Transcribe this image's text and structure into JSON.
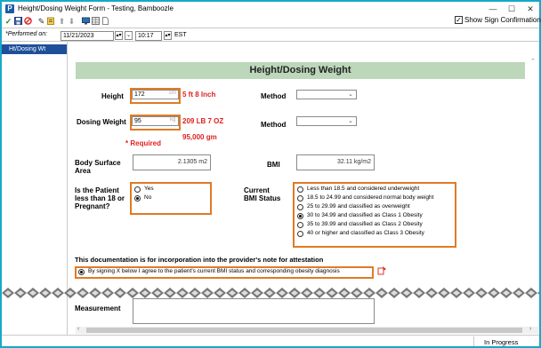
{
  "window": {
    "title": "Height/Dosing Weight Form - Testing, Bamboozle",
    "app_icon_letter": "P",
    "minimize": "—",
    "maximize": "☐",
    "close": "✕"
  },
  "toolbar": {
    "show_sign_confirmation_label": "Show Sign Confirmation",
    "show_sign_confirmation_checked": true,
    "check_mark": "✓"
  },
  "performed": {
    "label": "*Performed on:",
    "date": "11/21/2023",
    "time": "10:17",
    "timezone": "EST"
  },
  "nav": {
    "items": [
      {
        "label": "Ht/Dosing Wt"
      }
    ]
  },
  "form": {
    "section_title": "Height/Dosing Weight",
    "height": {
      "label": "Height",
      "value": "172",
      "unit": "cm",
      "converted": "5 ft 8 Inch"
    },
    "method_label": "Method",
    "dosing_weight": {
      "label": "Dosing Weight",
      "value": "95",
      "unit": "kg",
      "converted_lb": "209 LB 7 OZ",
      "converted_gm": "95,000 gm"
    },
    "required_note": "* Required",
    "bsa": {
      "label_line1": "Body Surface",
      "label_line2": "Area",
      "value": "2.1305 m2"
    },
    "bmi": {
      "label": "BMI",
      "value": "32.11 kg/m2"
    },
    "pregnant": {
      "label_line1": "Is the Patient",
      "label_line2": "less than 18 or",
      "label_line3": "Pregnant?",
      "options": [
        {
          "label": "Yes",
          "selected": false
        },
        {
          "label": "No",
          "selected": true
        }
      ]
    },
    "bmi_status": {
      "label_line1": "Current",
      "label_line2": "BMI Status",
      "options": [
        {
          "label": "Less than 18.5 and considered underweight",
          "selected": false
        },
        {
          "label": "18.5 to 24.99 and considered normal body weight",
          "selected": false
        },
        {
          "label": "25 to 29.99 and classified as overweight",
          "selected": false
        },
        {
          "label": "30 to 34.99 and classified as Class 1 Obesity",
          "selected": true
        },
        {
          "label": "35 to 39.99 and classified as Class 2 Obesity",
          "selected": false
        },
        {
          "label": "40 or higher and classified as Class 3 Obesity",
          "selected": false
        }
      ]
    },
    "attestation_note": "This documentation is for incorporation into the provider's note for attestation",
    "attestation_option": "By signing X below I agree to the patient's current BMI status and corresponding obesity diagnosis",
    "measurement_label": "Measurement"
  },
  "status": {
    "text": "In Progress"
  },
  "colors": {
    "frame": "#17a8c8",
    "header_green": "#bcd7b9",
    "highlight_orange": "#e07b24",
    "red_text": "#e02020",
    "nav_selected": "#1e4f9a"
  }
}
